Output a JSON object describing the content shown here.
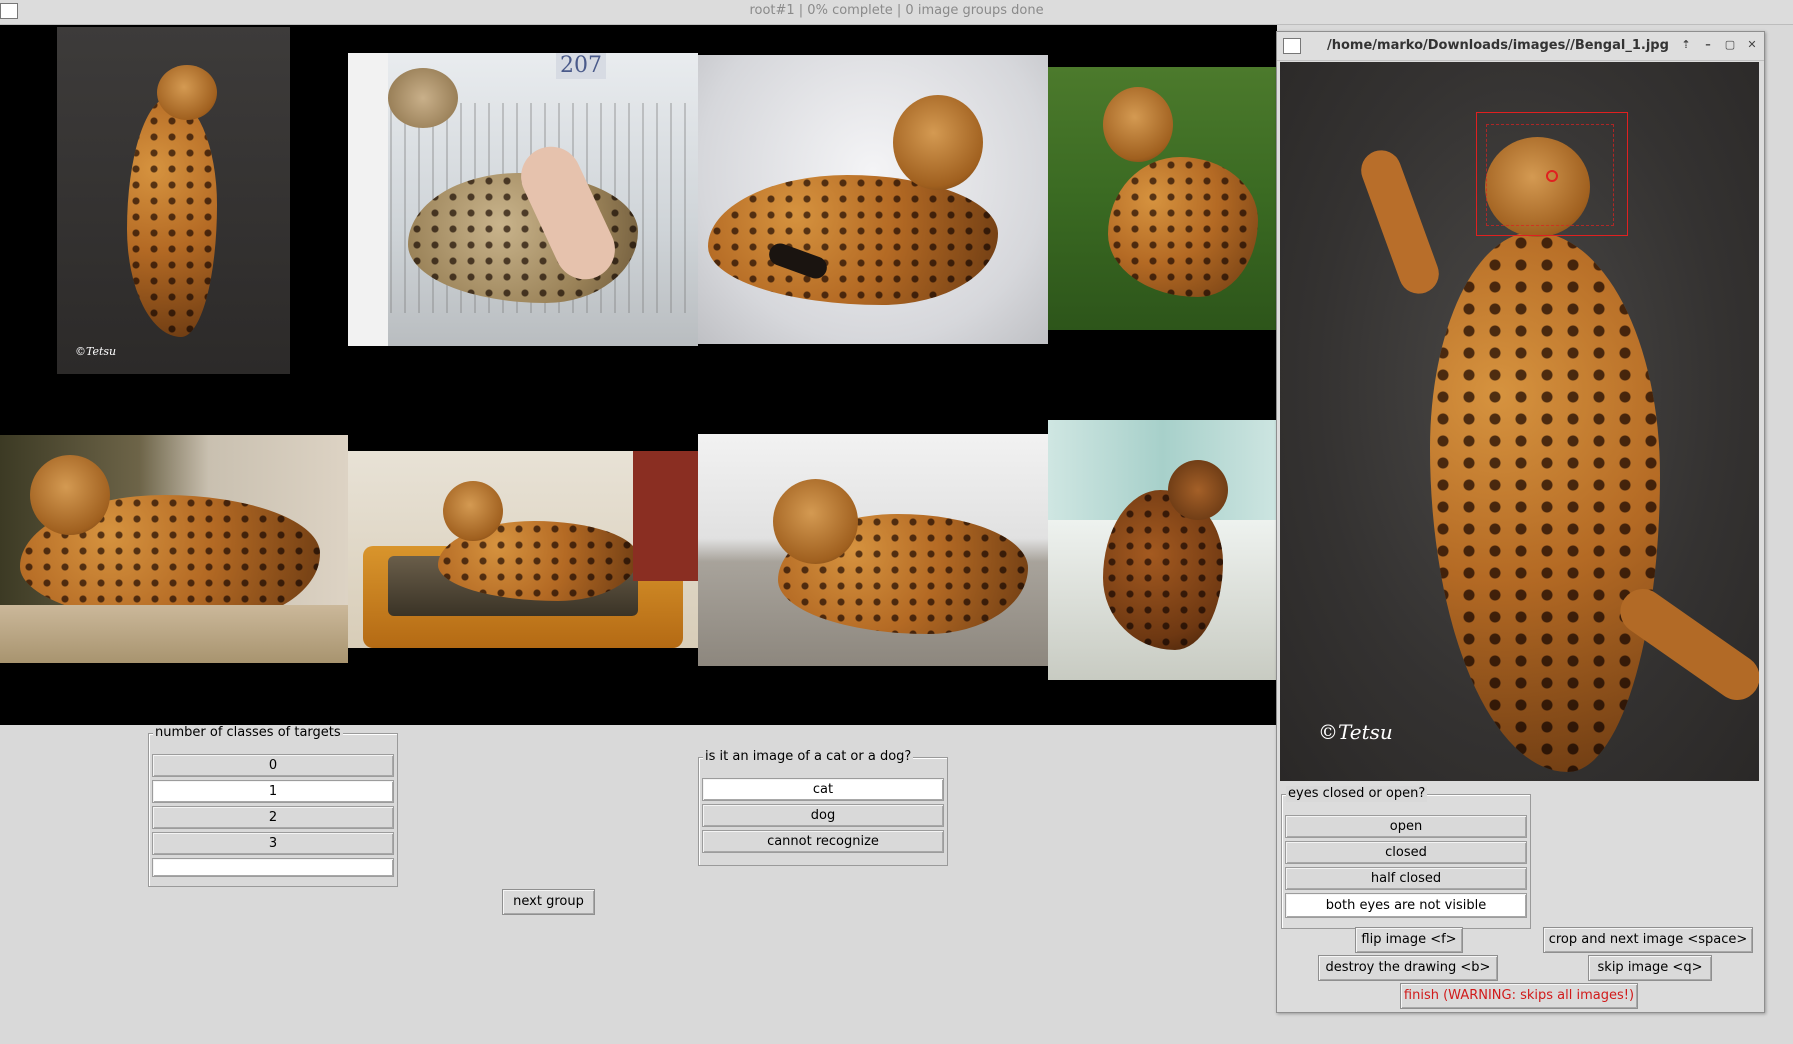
{
  "window": {
    "title": "root#1 | 0% complete | 0 image groups done",
    "icon": "window-icon"
  },
  "gallery": {
    "thumbnails": [
      {
        "caption": "©Tetsu"
      },
      {
        "caption": "207"
      },
      {
        "caption": ""
      },
      {
        "caption": ""
      },
      {
        "caption": ""
      },
      {
        "caption": ""
      },
      {
        "caption": ""
      },
      {
        "caption": ""
      }
    ]
  },
  "classes_group": {
    "title": "number of classes of targets",
    "options": [
      "0",
      "1",
      "2",
      "3",
      ""
    ],
    "selected_index": 1
  },
  "species_group": {
    "title": "is it an image of a cat or a dog?",
    "options": [
      "cat",
      "dog",
      "cannot recognize"
    ],
    "selected_index": 0
  },
  "next_group_label": "next group",
  "viewer": {
    "title": "/home/marko/Downloads/images//Bengal_1.jpg",
    "controls": [
      "up-arrow-icon",
      "minimize-icon",
      "maximize-icon",
      "close-icon"
    ],
    "watermark": "©Tetsu",
    "eyes_group": {
      "title": "eyes closed or open?",
      "options": [
        "open",
        "closed",
        "half closed",
        "both eyes are not visible"
      ],
      "selected_index": 3
    },
    "buttons": {
      "flip": "flip image <f>",
      "crop_next": "crop and next image <space>",
      "destroy": "destroy the drawing <b>",
      "skip": "skip image <q>",
      "finish": "finish (WARNING: skips all images!)"
    },
    "colors": {
      "bbox": "#e02020",
      "finish_text": "#d11a1a"
    }
  }
}
